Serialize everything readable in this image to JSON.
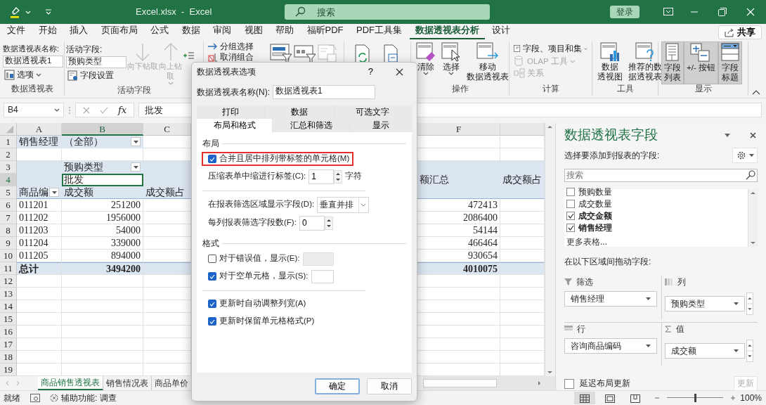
{
  "window": {
    "title": "Excel.xlsx  -  Excel",
    "search_placeholder": "搜索",
    "sign_in": "登录"
  },
  "menu_tabs": [
    {
      "label": "文件",
      "selected": false
    },
    {
      "label": "开始",
      "selected": false
    },
    {
      "label": "插入",
      "selected": false
    },
    {
      "label": "页面布局",
      "selected": false
    },
    {
      "label": "公式",
      "selected": false
    },
    {
      "label": "数据",
      "selected": false
    },
    {
      "label": "审阅",
      "selected": false
    },
    {
      "label": "视图",
      "selected": false
    },
    {
      "label": "帮助",
      "selected": false
    },
    {
      "label": "福昕PDF",
      "selected": false
    },
    {
      "label": "PDF工具集",
      "selected": false
    },
    {
      "label": "数据透视表分析",
      "selected": true
    },
    {
      "label": "设计",
      "selected": false
    }
  ],
  "share": "共享",
  "ribbon": {
    "pivot_group": {
      "name_label": "数据透视表名称:",
      "name_value": "数据透视表1",
      "options": "选项",
      "label": "数据透视表"
    },
    "field_group": {
      "field_label": "活动字段:",
      "field_value": "预购类型",
      "settings": "字段设置",
      "drill_down": {
        "lines": [
          "向下钻取"
        ],
        "disabled": true
      },
      "drill_up": {
        "lines": [
          "向上钻",
          "取"
        ],
        "disabled": true
      },
      "label": "活动字段"
    },
    "group_commands": [
      {
        "label": "分组选择"
      },
      {
        "label": "取消组合"
      }
    ],
    "actions": {
      "buttons": [
        {
          "lines": [
            "清除"
          ],
          "menu": true
        },
        {
          "lines": [
            "选择"
          ],
          "menu": true
        },
        {
          "lines": [
            "移动",
            "数据透视表"
          ],
          "menu": false
        }
      ],
      "label": "操作"
    },
    "calculations": {
      "buttons": [
        {
          "label": "字段、项目和集",
          "menu": true,
          "disabled": false
        },
        {
          "label": "OLAP 工具",
          "menu": true,
          "disabled": true
        },
        {
          "label": "关系",
          "menu": false,
          "disabled": true
        }
      ],
      "label": "计算"
    },
    "tools": {
      "buttons": [
        {
          "lines": [
            "数据",
            "透视图"
          ]
        },
        {
          "lines": [
            "推荐的数",
            "据透视表"
          ]
        }
      ],
      "label": "工具"
    },
    "show": {
      "buttons": [
        {
          "lines": [
            "字段",
            "列表"
          ],
          "on": true
        },
        {
          "lines": [
            "+/- 按钮"
          ],
          "on": true
        },
        {
          "lines": [
            "字段",
            "标题"
          ],
          "on": true
        }
      ],
      "label": "显示"
    }
  },
  "formula_bar": {
    "name_box": "B4",
    "function_label": "fx",
    "formula": "批发"
  },
  "sheet": {
    "columns": [
      {
        "label": "A",
        "selected": false
      },
      {
        "label": "B",
        "selected": true
      },
      {
        "label": "C",
        "selected": false
      },
      {
        "label": "F",
        "selected": false
      }
    ],
    "rows": [
      {
        "num": "1",
        "kind": "filter",
        "selected": false,
        "cells": {
          "A": {
            "text": "销售经理"
          },
          "B": {
            "text": "（全部）",
            "dropdown": true
          }
        }
      },
      {
        "num": "2",
        "kind": "body",
        "selected": false,
        "cells": {}
      },
      {
        "num": "3",
        "kind": "header",
        "selected": false,
        "cells": {
          "B": {
            "text": "预购类型",
            "dropdown": true
          }
        }
      },
      {
        "num": "4",
        "kind": "header",
        "selected": true,
        "cells": {
          "B": {
            "text": "批发",
            "selected": true
          },
          "F": {
            "text": "额汇总"
          },
          "column_7": {
            "text": "成交额占"
          }
        }
      },
      {
        "num": "5",
        "kind": "header",
        "selected": false,
        "cells": {
          "A": {
            "text": "商品编",
            "dropdown": true
          },
          "B": {
            "text": "成交额"
          },
          "C": {
            "text": "成交额占"
          }
        }
      },
      {
        "num": "6",
        "kind": "body",
        "selected": false,
        "cells": {
          "A": {
            "text": "011201"
          },
          "B": {
            "text": "251200"
          },
          "F": {
            "text": "472413"
          }
        }
      },
      {
        "num": "7",
        "kind": "body",
        "selected": false,
        "cells": {
          "A": {
            "text": "011202"
          },
          "B": {
            "text": "1956000"
          },
          "F": {
            "text": "2086400"
          }
        }
      },
      {
        "num": "8",
        "kind": "body",
        "selected": false,
        "cells": {
          "A": {
            "text": "011203"
          },
          "B": {
            "text": "54000"
          },
          "F": {
            "text": "54144"
          }
        }
      },
      {
        "num": "9",
        "kind": "body",
        "selected": false,
        "cells": {
          "A": {
            "text": "011204"
          },
          "B": {
            "text": "339000"
          },
          "F": {
            "text": "466464"
          }
        }
      },
      {
        "num": "10",
        "kind": "body",
        "selected": false,
        "cells": {
          "A": {
            "text": "011205"
          },
          "B": {
            "text": "894000"
          },
          "F": {
            "text": "930654"
          }
        }
      },
      {
        "num": "11",
        "kind": "total",
        "selected": false,
        "cells": {
          "A": {
            "text": "总计"
          },
          "B": {
            "text": "3494200"
          },
          "F": {
            "text": "4010075"
          }
        }
      },
      {
        "num": "12",
        "kind": "body",
        "selected": false,
        "cells": {}
      },
      {
        "num": "13",
        "kind": "body",
        "selected": false,
        "cells": {}
      },
      {
        "num": "14",
        "kind": "body",
        "selected": false,
        "cells": {}
      },
      {
        "num": "15",
        "kind": "body",
        "selected": false,
        "cells": {}
      },
      {
        "num": "16",
        "kind": "body",
        "selected": false,
        "cells": {}
      },
      {
        "num": "17",
        "kind": "body",
        "selected": false,
        "cells": {}
      },
      {
        "num": "18",
        "kind": "body",
        "selected": false,
        "cells": {}
      },
      {
        "num": "19",
        "kind": "body",
        "selected": false,
        "cells": {}
      }
    ]
  },
  "sheet_tabs": [
    {
      "label": "商品销售透视表",
      "selected": true
    },
    {
      "label": "销售情况表",
      "selected": false
    },
    {
      "label": "商品单价",
      "selected": false
    }
  ],
  "status_bar": {
    "ready": "就绪",
    "accessibility": "辅助功能: 调查",
    "views": [
      {
        "selected": true
      },
      {
        "selected": false
      },
      {
        "selected": false
      }
    ],
    "zoom_slider": {
      "level": 0.5
    },
    "zoom": "100%"
  },
  "field_pane": {
    "title": "数据透视表字段",
    "prompt": "选择要添加到报表的字段:",
    "search_placeholder": "搜索",
    "fields": [
      {
        "label": "预购数量",
        "checked": false
      },
      {
        "label": "成交数量",
        "checked": false
      },
      {
        "label": "成交金额",
        "checked": true
      },
      {
        "label": "销售经理",
        "checked": true
      }
    ],
    "more_tables": "更多表格...",
    "drag_prompt": "在以下区域间拖动字段:",
    "areas": [
      {
        "kind": "filter",
        "label": "筛选",
        "items": [
          "销售经理"
        ]
      },
      {
        "kind": "columns",
        "label": "列",
        "items": [
          "预购类型"
        ]
      },
      {
        "kind": "rows",
        "label": "行",
        "items": [
          "咨询商品编码"
        ]
      },
      {
        "kind": "values",
        "label": "值",
        "items": [
          "成交额"
        ]
      }
    ],
    "defer": {
      "label": "延迟布局更新",
      "checked": false
    },
    "update": {
      "label": "更新",
      "disabled": true
    }
  },
  "dialog": {
    "title": "数据透视表选项",
    "help": "?",
    "name_label": "数据透视表名称(N):",
    "name_value": "数据透视表1",
    "tab_rows": [
      [
        {
          "label": "打印",
          "selected": false
        },
        {
          "label": "数据",
          "selected": false
        },
        {
          "label": "可选文字",
          "selected": false
        }
      ],
      [
        {
          "label": "布局和格式",
          "selected": true
        },
        {
          "label": "汇总和筛选",
          "selected": false
        },
        {
          "label": "显示",
          "selected": false
        }
      ]
    ],
    "sections": [
      {
        "title": "布局",
        "items": [
          {
            "kind": "checkbox",
            "label": "合并且居中排列带标签的单元格(M)",
            "checked": true,
            "highlighted": true
          },
          {
            "kind": "spin",
            "label": "压缩表单中缩进行标签(C):",
            "value": "1",
            "suffix": "字符"
          }
        ]
      },
      {
        "items": [
          {
            "kind": "select",
            "label": "在报表筛选区域显示字段(D):",
            "value": "垂直并排"
          },
          {
            "kind": "spin",
            "label": "每列报表筛选字段数(F):",
            "value": "0"
          }
        ]
      },
      {
        "title": "格式",
        "items": [
          {
            "kind": "checkbox_field",
            "label": "对于错误值，显示(E):",
            "checked": false
          },
          {
            "kind": "checkbox_field",
            "label": "对于空单元格，显示(S):",
            "checked": true
          }
        ]
      },
      {
        "items": [
          {
            "kind": "checkbox",
            "label": "更新时自动调整列宽(A)",
            "checked": true,
            "highlighted": false
          },
          {
            "kind": "checkbox",
            "label": "更新时保留单元格格式(P)",
            "checked": true,
            "highlighted": false
          }
        ]
      }
    ],
    "buttons": [
      {
        "label": "确定",
        "default": true
      },
      {
        "label": "取消",
        "default": false
      }
    ]
  }
}
